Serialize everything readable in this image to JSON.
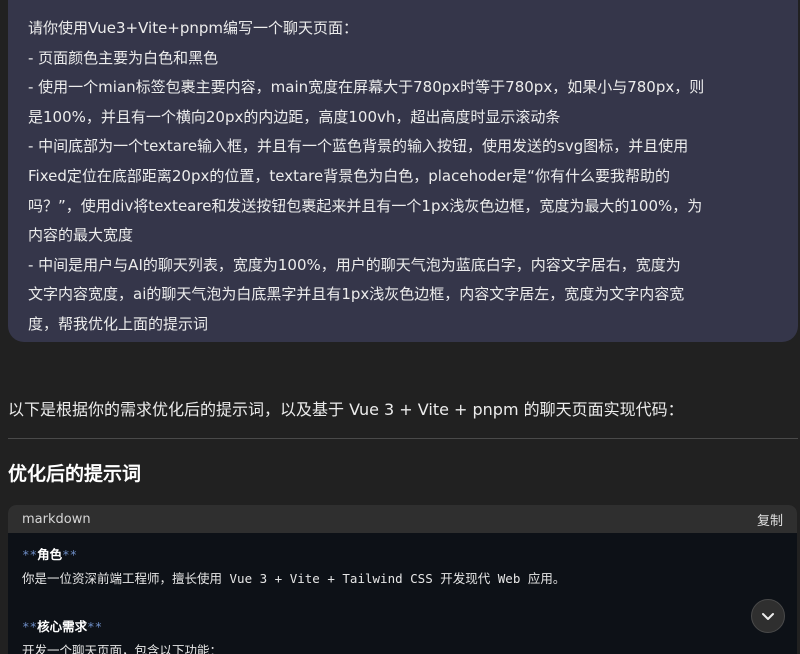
{
  "user_message": {
    "lines": [
      "请你使用Vue3+Vite+pnpm编写一个聊天页面：",
      " - 页面颜色主要为白色和黑色",
      " - 使用一个mian标签包裹主要内容，main宽度在屏幕大于780px时等于780px，如果小与780px，则",
      "是100%，并且有一个横向20px的内边距，高度100vh，超出高度时显示滚动条",
      " - 中间底部为一个textare输入框，并且有一个蓝色背景的输入按钮，使用发送的svg图标，并且使用",
      "Fixed定位在底部距离20px的位置，textare背景色为白色，placehoder是“你有什么要我帮助的",
      "吗？”，使用div将texteare和发送按钮包裹起来并且有一个1px浅灰色边框，宽度为最大的100%，为",
      "内容的最大宽度",
      " - 中间是用户与AI的聊天列表，宽度为100%，用户的聊天气泡为蓝底白字，内容文字居右，宽度为",
      "文字内容宽度，ai的聊天气泡为白底黑字并且有1px浅灰色边框，内容文字居左，宽度为文字内容宽",
      "度，帮我优化上面的提示词"
    ]
  },
  "assistant": {
    "intro": "以下是根据你的需求优化后的提示词，以及基于 Vue 3 + Vite + pnpm 的聊天页面实现代码：",
    "heading": "优化后的提示词"
  },
  "code_block": {
    "language": "markdown",
    "copy_label": "复制",
    "md_mark": "**",
    "role_heading": "角色",
    "role_text": "你是一位资深前端工程师，擅长使用 Vue 3 + Vite + Tailwind CSS 开发现代 Web 应用。",
    "core_heading": "核心需求",
    "core_text": "开发一个聊天页面，包含以下功能："
  },
  "icons": {
    "scroll_down": "chevron-down-icon"
  },
  "colors": {
    "background": "#212121",
    "user_bubble": "#35364a",
    "code_header": "#2f2f2f",
    "code_body": "#0d1117",
    "markdown_mark": "#6f8fc8"
  }
}
